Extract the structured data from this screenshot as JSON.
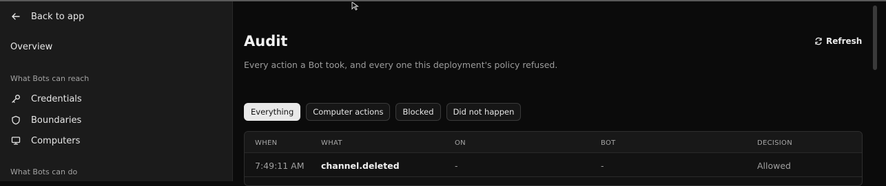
{
  "sidebar": {
    "back_label": "Back to app",
    "overview_label": "Overview",
    "section_reach": "What Bots can reach",
    "items": [
      {
        "label": "Credentials",
        "icon": "key-icon"
      },
      {
        "label": "Boundaries",
        "icon": "shield-icon"
      },
      {
        "label": "Computers",
        "icon": "monitor-icon"
      }
    ],
    "section_do": "What Bots can do"
  },
  "main": {
    "title": "Audit",
    "subtitle": "Every action a Bot took, and every one this deployment's policy refused.",
    "refresh_label": "Refresh",
    "filters": [
      {
        "label": "Everything",
        "active": true
      },
      {
        "label": "Computer actions",
        "active": false
      },
      {
        "label": "Blocked",
        "active": false
      },
      {
        "label": "Did not happen",
        "active": false
      }
    ],
    "table": {
      "headers": [
        "WHEN",
        "WHAT",
        "ON",
        "BOT",
        "DECISION"
      ],
      "rows": [
        {
          "when": "7:49:11 AM",
          "what": "channel.deleted",
          "on": "-",
          "bot": "-",
          "decision": "Allowed"
        }
      ]
    }
  },
  "colors": {
    "background": "#0b0b0b",
    "sidebar": "#1b1b1b",
    "active_chip": "#e9e9e9"
  }
}
